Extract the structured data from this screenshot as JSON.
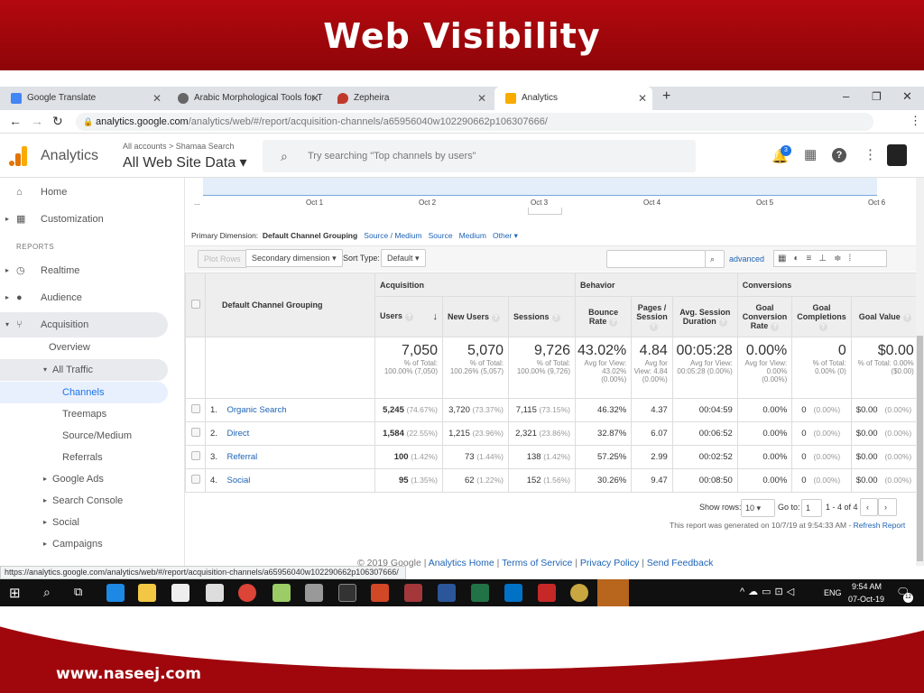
{
  "slide": {
    "title": "Web Visibility",
    "footer": "www.naseej.com"
  },
  "browser": {
    "tabs": [
      {
        "label": "Google Translate",
        "color": "#4285f4"
      },
      {
        "label": "Arabic Morphological Tools for T",
        "color": "#555555"
      },
      {
        "label": "Zepheira",
        "color": "#c0392b"
      },
      {
        "label": "Analytics",
        "color": "#f9ab00"
      }
    ],
    "url_host": "analytics.google.com",
    "url_path": "/analytics/web/#/report/acquisition-channels/a65956040w102290662p106307666/",
    "status_url": "https://analytics.google.com/analytics/web/#/report/acquisition-channels/a65956040w102290662p106307666/"
  },
  "header": {
    "app": "Analytics",
    "breadcrumb": "All accounts > Shamaa Search",
    "view": "All Web Site Data",
    "search_placeholder": "Try searching \"Top channels by users\"",
    "notifications": "3"
  },
  "sidebar": {
    "home": "Home",
    "customization": "Customization",
    "reports": "REPORTS",
    "realtime": "Realtime",
    "audience": "Audience",
    "acquisition": "Acquisition",
    "overview": "Overview",
    "all_traffic": "All Traffic",
    "channels": "Channels",
    "treemaps": "Treemaps",
    "source_medium": "Source/Medium",
    "referrals": "Referrals",
    "google_ads": "Google Ads",
    "search_console": "Search Console",
    "social": "Social",
    "campaigns": "Campaigns"
  },
  "chart": {
    "x_labels": [
      "...",
      "Oct 1",
      "Oct 2",
      "Oct 3",
      "Oct 4",
      "Oct 5",
      "Oct 6"
    ]
  },
  "dimension": {
    "label": "Primary Dimension:",
    "active": "Default Channel Grouping",
    "options": [
      "Source / Medium",
      "Source",
      "Medium",
      "Other"
    ]
  },
  "toolbar": {
    "plot_rows": "Plot Rows",
    "secondary": "Secondary dimension",
    "sort_label": "Sort Type:",
    "sort_value": "Default",
    "advanced": "advanced"
  },
  "table": {
    "groups": {
      "acquisition": "Acquisition",
      "behavior": "Behavior",
      "conversions": "Conversions"
    },
    "dim_header": "Default Channel Grouping",
    "headers": [
      "Users",
      "New Users",
      "Sessions",
      "Bounce Rate",
      "Pages / Session",
      "Avg. Session Duration",
      "Goal Conversion Rate",
      "Goal Completions",
      "Goal Value"
    ],
    "totals": [
      {
        "v": "7,050",
        "s": "% of Total: 100.00% (7,050)"
      },
      {
        "v": "5,070",
        "s": "% of Total: 100.26% (5,057)"
      },
      {
        "v": "9,726",
        "s": "% of Total: 100.00% (9,726)"
      },
      {
        "v": "43.02%",
        "s": "Avg for View: 43.02% (0.00%)"
      },
      {
        "v": "4.84",
        "s": "Avg for View: 4.84 (0.00%)"
      },
      {
        "v": "00:05:28",
        "s": "Avg for View: 00:05:28 (0.00%)"
      },
      {
        "v": "0.00%",
        "s": "Avg for View: 0.00% (0.00%)"
      },
      {
        "v": "0",
        "s": "% of Total: 0.00% (0)"
      },
      {
        "v": "$0.00",
        "s": "% of Total: 0.00% ($0.00)"
      }
    ],
    "rows": [
      {
        "n": "1.",
        "name": "Organic Search",
        "users": "5,245",
        "users_p": "(74.67%)",
        "new": "3,720",
        "new_p": "(73.37%)",
        "sess": "7,115",
        "sess_p": "(73.15%)",
        "bounce": "46.32%",
        "pages": "4.37",
        "dur": "00:04:59",
        "conv": "0.00%",
        "comp": "0",
        "comp_p": "(0.00%)",
        "val": "$0.00",
        "val_p": "(0.00%)"
      },
      {
        "n": "2.",
        "name": "Direct",
        "users": "1,584",
        "users_p": "(22.55%)",
        "new": "1,215",
        "new_p": "(23.96%)",
        "sess": "2,321",
        "sess_p": "(23.86%)",
        "bounce": "32.87%",
        "pages": "6.07",
        "dur": "00:06:52",
        "conv": "0.00%",
        "comp": "0",
        "comp_p": "(0.00%)",
        "val": "$0.00",
        "val_p": "(0.00%)"
      },
      {
        "n": "3.",
        "name": "Referral",
        "users": "100",
        "users_p": "(1.42%)",
        "new": "73",
        "new_p": "(1.44%)",
        "sess": "138",
        "sess_p": "(1.42%)",
        "bounce": "57.25%",
        "pages": "2.99",
        "dur": "00:02:52",
        "conv": "0.00%",
        "comp": "0",
        "comp_p": "(0.00%)",
        "val": "$0.00",
        "val_p": "(0.00%)"
      },
      {
        "n": "4.",
        "name": "Social",
        "users": "95",
        "users_p": "(1.35%)",
        "new": "62",
        "new_p": "(1.22%)",
        "sess": "152",
        "sess_p": "(1.56%)",
        "bounce": "30.26%",
        "pages": "9.47",
        "dur": "00:08:50",
        "conv": "0.00%",
        "comp": "0",
        "comp_p": "(0.00%)",
        "val": "$0.00",
        "val_p": "(0.00%)"
      }
    ]
  },
  "pager": {
    "show_rows": "Show rows:",
    "rows_value": "10",
    "goto": "Go to:",
    "goto_value": "1",
    "range": "1 - 4 of 4"
  },
  "report_note": "This report was generated on 10/7/19 at 9:54:33 AM - ",
  "refresh": "Refresh Report",
  "footer_links": {
    "copyright": "© 2019 Google",
    "links": [
      "Analytics Home",
      "Terms of Service",
      "Privacy Policy",
      "Send Feedback"
    ]
  },
  "taskbar": {
    "time": "9:54 AM",
    "date": "07-Oct-19",
    "lang": "ENG",
    "notif": "12"
  }
}
